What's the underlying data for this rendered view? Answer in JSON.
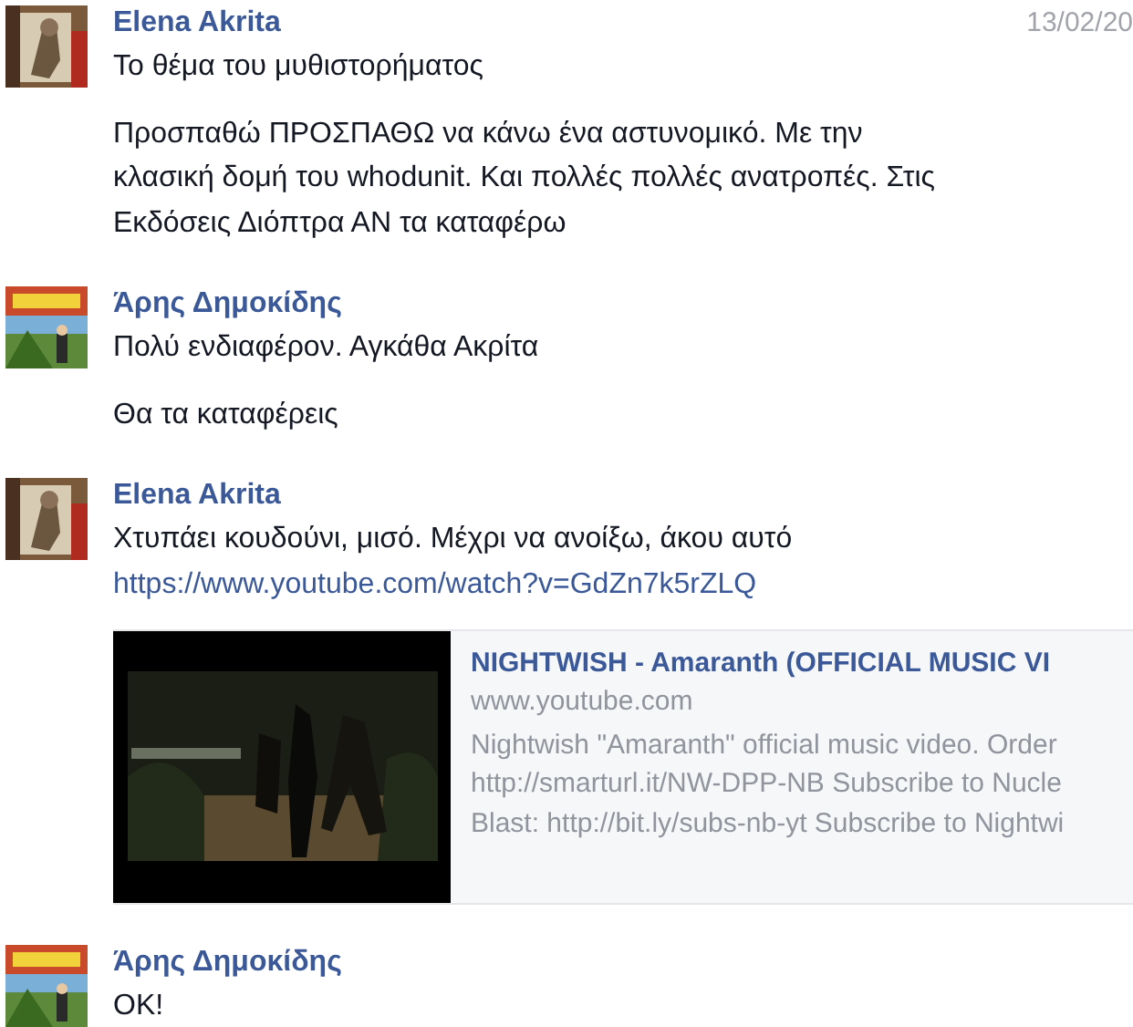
{
  "messages": [
    {
      "author": "Elena Akrita",
      "avatar": {
        "kind": "picture"
      },
      "time": "13/02/20",
      "paragraphs": [
        [
          "Το θέμα του μυθιστορήματος"
        ],
        [
          "Προσπαθώ ΠΡΟΣΠΑΘΩ να κάνω ένα αστυνομικό. Με την",
          "κλασική δομή του whodunit. Και πολλές πολλές ανατροπές. Στις",
          "Εκδόσεις Διόπτρα ΑΝ τα καταφέρω"
        ]
      ]
    },
    {
      "author": "Άρης Δημοκίδης",
      "avatar": {
        "kind": "picture"
      },
      "paragraphs": [
        [
          "Πολύ ενδιαφέρον. Αγκάθα Ακρίτα"
        ],
        [
          "Θα τα καταφέρεις"
        ]
      ]
    },
    {
      "author": "Elena Akrita",
      "avatar": {
        "kind": "picture"
      },
      "paragraphs": [
        [
          "Χτυπάει κουδούνι, μισό. Μέχρι να ανοίξω, άκου αυτό"
        ]
      ],
      "link": "https://www.youtube.com/watch?v=GdZn7k5rZLQ",
      "preview": {
        "title": "NIGHTWISH - Amaranth (OFFICIAL MUSIC VI",
        "domain": "www.youtube.com",
        "description": [
          "Nightwish \"Amaranth\" official music video. Order",
          "http://smarturl.it/NW-DPP-NB Subscribe to Nucle",
          "Blast: http://bit.ly/subs-nb-yt Subscribe to Nightwi"
        ]
      }
    },
    {
      "author": "Άρης Δημοκίδης",
      "avatar": {
        "kind": "picture"
      },
      "paragraphs": [
        [
          "OK!"
        ]
      ]
    }
  ]
}
